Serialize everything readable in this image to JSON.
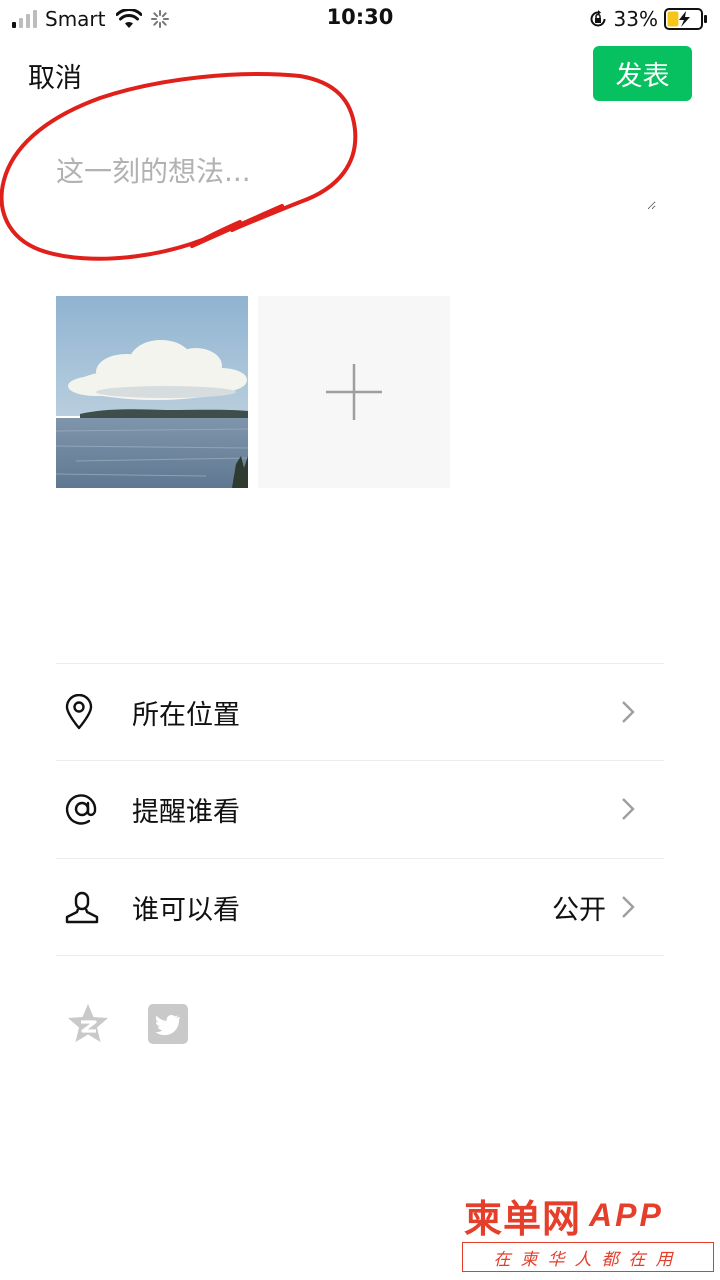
{
  "status_bar": {
    "carrier": "Smart",
    "time": "10:30",
    "battery_percent": "33%",
    "battery_level": 0.33,
    "signal_bars_active": 1,
    "signal_bars_total": 4,
    "icons": [
      "signal-icon",
      "wifi-icon",
      "loading-spinner-icon",
      "rotation-lock-icon",
      "battery-charging-icon"
    ]
  },
  "nav": {
    "cancel_label": "取消",
    "post_label": "发表",
    "post_color": "#07c160"
  },
  "composer": {
    "placeholder": "这一刻的想法...",
    "value": ""
  },
  "annotation": {
    "color": "#e0201b",
    "shape": "hand-drawn circle around text input"
  },
  "photos": {
    "add_icon": "plus-icon"
  },
  "options": [
    {
      "icon": "location-pin-icon",
      "label": "所在位置",
      "value": ""
    },
    {
      "icon": "at-sign-icon",
      "label": "提醒谁看",
      "value": ""
    },
    {
      "icon": "person-icon",
      "label": "谁可以看",
      "value": "公开"
    }
  ],
  "share": {
    "icons": [
      "qzone-icon",
      "twitter-icon"
    ],
    "icon_color": "#c9c9c9"
  },
  "watermark": {
    "logo": "柬单网",
    "app": "APP",
    "slogan": "在柬华人都在用",
    "color": "#e53e2b"
  }
}
